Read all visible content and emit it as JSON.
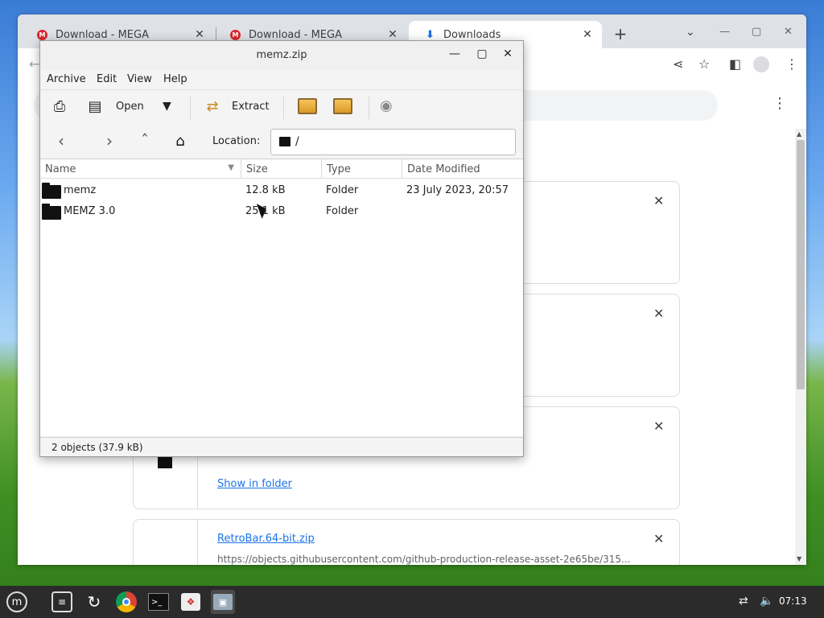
{
  "browser": {
    "tabs": [
      {
        "title": "Download - MEGA",
        "icon": "mega-icon",
        "active": false
      },
      {
        "title": "Download - MEGA",
        "icon": "mega-icon",
        "active": false
      },
      {
        "title": "Downloads",
        "icon": "download-icon",
        "active": true
      }
    ],
    "downloads": [
      {
        "link": "",
        "url": ""
      },
      {
        "link": "",
        "url": ""
      },
      {
        "link": "Show in folder",
        "url": ""
      },
      {
        "link": "RetroBar.64-bit.zip",
        "url": "https://objects.githubusercontent.com/github-production-release-asset-2e65be/315..."
      }
    ]
  },
  "archive": {
    "window_title": "memz.zip",
    "menu": [
      "Archive",
      "Edit",
      "View",
      "Help"
    ],
    "toolbar": {
      "open_label": "Open",
      "extract_label": "Extract"
    },
    "location_label": "Location:",
    "location_value": "/",
    "columns": [
      "Name",
      "Size",
      "Type",
      "Date Modified"
    ],
    "rows": [
      {
        "name": "memz",
        "size": "12.8 kB",
        "type": "Folder",
        "modified": "23 July 2023, 20:57"
      },
      {
        "name": "MEMZ 3.0",
        "size": "25.1 kB",
        "type": "Folder",
        "modified": ""
      }
    ],
    "status": "2 objects (37.9 kB)"
  },
  "taskbar": {
    "clock": "07:13"
  }
}
